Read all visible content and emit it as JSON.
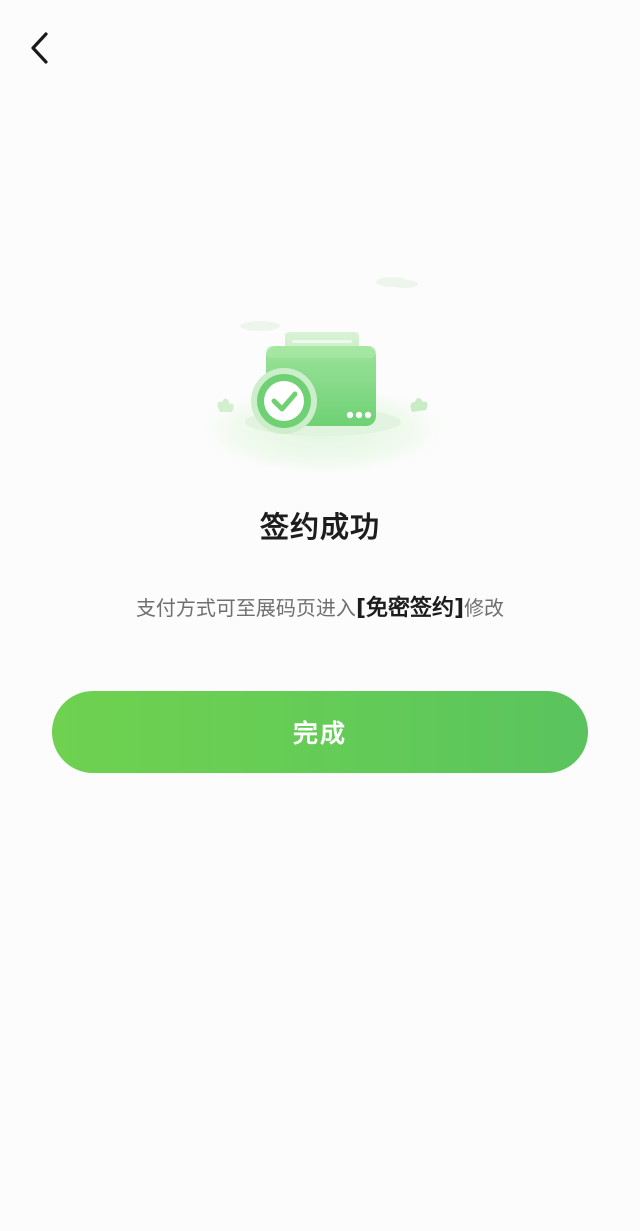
{
  "nav": {
    "back_icon": "chevron-left-icon"
  },
  "illustration": {
    "icon": "wallet-check-icon",
    "accent_color": "#5ccb5f",
    "light_color": "#a6e6a4"
  },
  "result": {
    "title": "签约成功",
    "desc_prefix": "支付方式可至展码页进入",
    "desc_highlight": "[免密签约]",
    "desc_suffix": "修改"
  },
  "actions": {
    "done_label": "完成",
    "button_color_start": "#6fd14f",
    "button_color_end": "#5ac35e"
  }
}
